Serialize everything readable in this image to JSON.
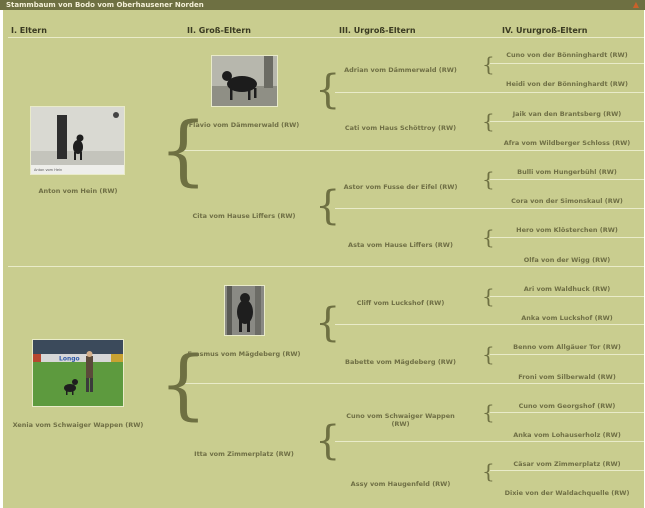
{
  "window": {
    "title": "Stammbaum von Bodo vom Oberhausener Norden",
    "corner_glyph": "▲"
  },
  "headers": [
    "I. Eltern",
    "II. Groß-Eltern",
    "III. Urgroß-Eltern",
    "IV. Ururgroß-Eltern"
  ],
  "gen1": [
    "Anton vom Hein (RW)",
    "Xenia vom Schwaiger Wappen (RW)"
  ],
  "gen2": [
    "Flavio vom Dämmerwald (RW)",
    "Cita vom Hause Liffers (RW)",
    "Erasmus vom Mägdeberg (RW)",
    "Itta vom Zimmerplatz (RW)"
  ],
  "gen3": [
    "Adrian vom Dämmerwald (RW)",
    "Cati vom Haus Schöttroy (RW)",
    "Astor vom Fusse der Eifel (RW)",
    "Asta vom Hause Liffers (RW)",
    "Cliff vom Luckshof (RW)",
    "Babette vom Mägdeberg (RW)",
    "Cuno vom Schwaiger Wappen (RW)",
    "Assy vom Haugenfeld (RW)"
  ],
  "gen4": [
    "Cuno von der Bönninghardt (RW)",
    "Heidi von der Bönninghardt (RW)",
    "Jaik van den Brantsberg (RW)",
    "Afra vom Wildberger Schloss (RW)",
    "Bulli vom Hungerbühl (RW)",
    "Cora von der Simonskaul (RW)",
    "Hero vom Klösterchen (RW)",
    "Olfa von der Wigg (RW)",
    "Ari vom Waldhuck (RW)",
    "Anka vom Luckshof (RW)",
    "Benno vom Allgäuer Tor (RW)",
    "Froni vom Silberwald (RW)",
    "Cuno vom Georgshof (RW)",
    "Anka vom Lohauserholz (RW)",
    "Cäsar vom Zimmerplatz (RW)",
    "Dixie von der Waldachquelle (RW)"
  ],
  "photos": {
    "anton_caption": "Anton vom Hein",
    "banner_text": "Longo"
  }
}
